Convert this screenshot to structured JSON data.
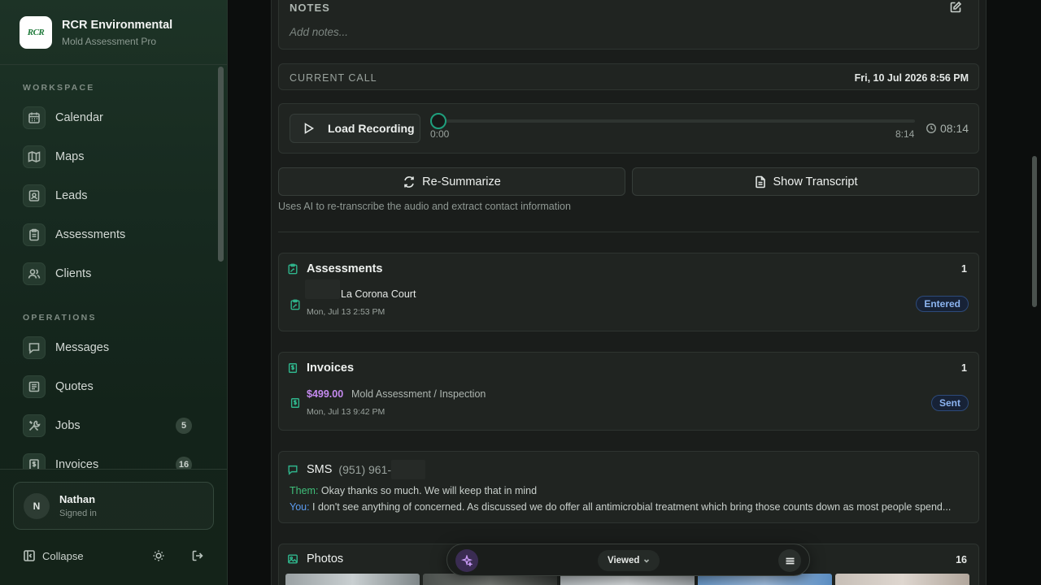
{
  "brand": {
    "name": "RCR Environmental",
    "subtitle": "Mold Assessment Pro",
    "logo_text": "RCR"
  },
  "sidebar": {
    "sections": [
      {
        "label": "WORKSPACE"
      },
      {
        "label": "OPERATIONS"
      }
    ],
    "items": [
      {
        "label": "Calendar",
        "icon": "calendar-icon"
      },
      {
        "label": "Maps",
        "icon": "map-icon"
      },
      {
        "label": "Leads",
        "icon": "contact-card-icon"
      },
      {
        "label": "Assessments",
        "icon": "clipboard-icon"
      },
      {
        "label": "Clients",
        "icon": "users-icon"
      },
      {
        "label": "Messages",
        "icon": "message-icon"
      },
      {
        "label": "Quotes",
        "icon": "receipt-icon"
      },
      {
        "label": "Jobs",
        "icon": "tools-icon",
        "badge": "5"
      },
      {
        "label": "Invoices",
        "icon": "invoice-icon",
        "badge": "16"
      }
    ],
    "user": {
      "initial": "N",
      "name": "Nathan",
      "status": "Signed in"
    },
    "collapse_label": "Collapse"
  },
  "notes": {
    "title": "NOTES",
    "placeholder": "Add notes..."
  },
  "call": {
    "label": "CURRENT CALL",
    "date": "Fri, 10 Jul 2026 8:56 PM"
  },
  "player": {
    "button_label": "Load Recording",
    "time_start": "0:00",
    "time_end": "8:14",
    "duration": "08:14",
    "progress": 0
  },
  "actions": {
    "resummarize_label": "Re-Summarize",
    "transcript_label": "Show Transcript",
    "hint": "Uses AI to re-transcribe the audio and extract contact information"
  },
  "assessments": {
    "title": "Assessments",
    "count": "1",
    "item": {
      "title": "La Corona Court",
      "date": "Mon, Jul 13 2:53 PM",
      "status": "Entered"
    }
  },
  "invoices": {
    "title": "Invoices",
    "count": "1",
    "item": {
      "amount": "$499.00",
      "description": "Mold Assessment / Inspection",
      "date": "Mon, Jul 13 9:42 PM",
      "status": "Sent"
    }
  },
  "sms": {
    "title": "SMS",
    "phone": "(951) 961-",
    "messages": [
      {
        "sender": "Them:",
        "text": " Okay thanks so much. We will keep that in mind"
      },
      {
        "sender": "You:",
        "text": " I don't see anything of concerned. As discussed we do offer all antimicrobial treatment which bring those counts down as most people spend..."
      }
    ]
  },
  "photos": {
    "title": "Photos",
    "count": "16"
  },
  "floatbar": {
    "filter_label": "Viewed"
  },
  "colors": {
    "accent": "#2fb58c",
    "invoice_amount": "#c58af0",
    "status_pill": "#8cb4f0"
  }
}
